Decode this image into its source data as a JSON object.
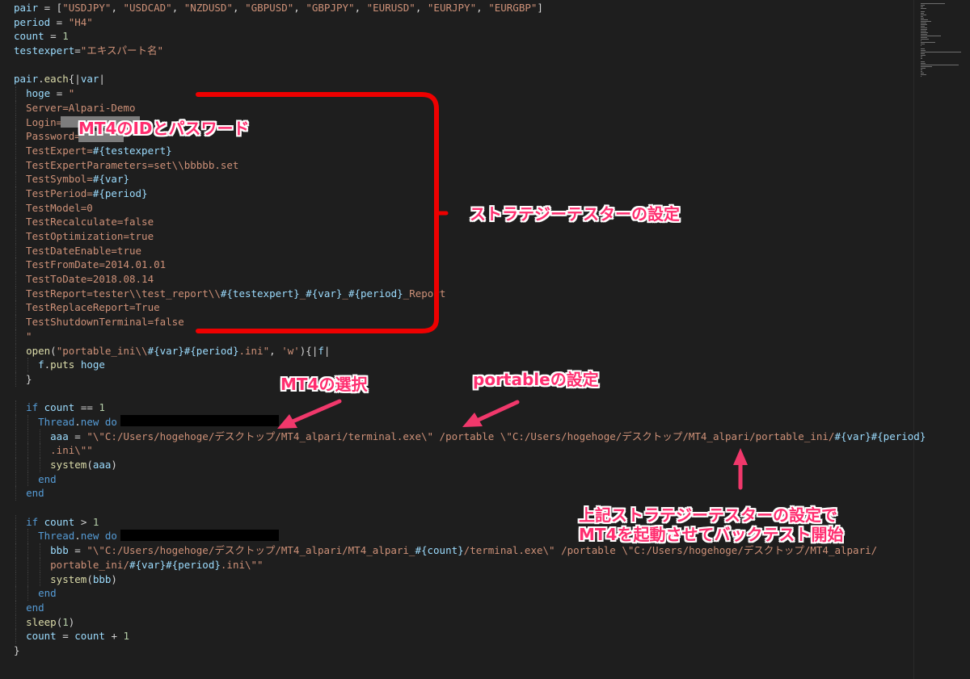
{
  "code_lines": [
    [
      {
        "c": "id",
        "t": "pair"
      },
      {
        "c": "op",
        "t": " = ["
      },
      {
        "c": "str",
        "t": "\"USDJPY\""
      },
      {
        "c": "op",
        "t": ", "
      },
      {
        "c": "str",
        "t": "\"USDCAD\""
      },
      {
        "c": "op",
        "t": ", "
      },
      {
        "c": "str",
        "t": "\"NZDUSD\""
      },
      {
        "c": "op",
        "t": ", "
      },
      {
        "c": "str",
        "t": "\"GBPUSD\""
      },
      {
        "c": "op",
        "t": ", "
      },
      {
        "c": "str",
        "t": "\"GBPJPY\""
      },
      {
        "c": "op",
        "t": ", "
      },
      {
        "c": "str",
        "t": "\"EURUSD\""
      },
      {
        "c": "op",
        "t": ", "
      },
      {
        "c": "str",
        "t": "\"EURJPY\""
      },
      {
        "c": "op",
        "t": ", "
      },
      {
        "c": "str",
        "t": "\"EURGBP\""
      },
      {
        "c": "op",
        "t": "]"
      }
    ],
    [
      {
        "c": "id",
        "t": "period"
      },
      {
        "c": "op",
        "t": " = "
      },
      {
        "c": "str",
        "t": "\"H4\""
      }
    ],
    [
      {
        "c": "id",
        "t": "count"
      },
      {
        "c": "op",
        "t": " = "
      },
      {
        "c": "num",
        "t": "1"
      }
    ],
    [
      {
        "c": "id",
        "t": "testexpert"
      },
      {
        "c": "op",
        "t": "="
      },
      {
        "c": "str",
        "t": "\"エキスパート名\""
      }
    ],
    [],
    [
      {
        "c": "id",
        "t": "pair"
      },
      {
        "c": "op",
        "t": "."
      },
      {
        "c": "fn",
        "t": "each"
      },
      {
        "c": "op",
        "t": "{|"
      },
      {
        "c": "id",
        "t": "var"
      },
      {
        "c": "op",
        "t": "|"
      }
    ],
    [
      {
        "c": "op",
        "t": "  "
      },
      {
        "c": "id",
        "t": "hoge"
      },
      {
        "c": "op",
        "t": " = "
      },
      {
        "c": "str",
        "t": "\""
      }
    ],
    [
      {
        "c": "str",
        "t": "  Server=Alpari-Demo"
      }
    ],
    [
      {
        "c": "str",
        "t": "  Login="
      }
    ],
    [
      {
        "c": "str",
        "t": "  Password="
      }
    ],
    [
      {
        "c": "str",
        "t": "  TestExpert="
      },
      {
        "c": "interp",
        "t": "#{testexpert}"
      }
    ],
    [
      {
        "c": "str",
        "t": "  TestExpertParameters=set\\\\bbbbb.set"
      }
    ],
    [
      {
        "c": "str",
        "t": "  TestSymbol="
      },
      {
        "c": "interp",
        "t": "#{var}"
      }
    ],
    [
      {
        "c": "str",
        "t": "  TestPeriod="
      },
      {
        "c": "interp",
        "t": "#{period}"
      }
    ],
    [
      {
        "c": "str",
        "t": "  TestModel=0"
      }
    ],
    [
      {
        "c": "str",
        "t": "  TestRecalculate=false"
      }
    ],
    [
      {
        "c": "str",
        "t": "  TestOptimization=true"
      }
    ],
    [
      {
        "c": "str",
        "t": "  TestDateEnable=true"
      }
    ],
    [
      {
        "c": "str",
        "t": "  TestFromDate=2014.01.01"
      }
    ],
    [
      {
        "c": "str",
        "t": "  TestToDate=2018.08.14"
      }
    ],
    [
      {
        "c": "str",
        "t": "  TestReport=tester\\\\test_report\\\\"
      },
      {
        "c": "interp",
        "t": "#{testexpert}"
      },
      {
        "c": "str",
        "t": "_"
      },
      {
        "c": "interp",
        "t": "#{var}"
      },
      {
        "c": "str",
        "t": "_"
      },
      {
        "c": "interp",
        "t": "#{period}"
      },
      {
        "c": "str",
        "t": "_Report"
      }
    ],
    [
      {
        "c": "str",
        "t": "  TestReplaceReport=True"
      }
    ],
    [
      {
        "c": "str",
        "t": "  TestShutdownTerminal=false"
      }
    ],
    [
      {
        "c": "str",
        "t": "  \""
      }
    ],
    [
      {
        "c": "op",
        "t": "  "
      },
      {
        "c": "fn",
        "t": "open"
      },
      {
        "c": "op",
        "t": "("
      },
      {
        "c": "str",
        "t": "\"portable_ini\\\\"
      },
      {
        "c": "interp",
        "t": "#{var}#{period}"
      },
      {
        "c": "str",
        "t": ".ini\""
      },
      {
        "c": "op",
        "t": ", "
      },
      {
        "c": "str",
        "t": "'w'"
      },
      {
        "c": "op",
        "t": "){|"
      },
      {
        "c": "id",
        "t": "f"
      },
      {
        "c": "op",
        "t": "|"
      }
    ],
    [
      {
        "c": "op",
        "t": "    "
      },
      {
        "c": "id",
        "t": "f"
      },
      {
        "c": "op",
        "t": "."
      },
      {
        "c": "fn",
        "t": "puts"
      },
      {
        "c": "op",
        "t": " "
      },
      {
        "c": "id",
        "t": "hoge"
      }
    ],
    [
      {
        "c": "op",
        "t": "  }"
      }
    ],
    [],
    [
      {
        "c": "op",
        "t": "  "
      },
      {
        "c": "kw",
        "t": "if"
      },
      {
        "c": "op",
        "t": " "
      },
      {
        "c": "id",
        "t": "count"
      },
      {
        "c": "op",
        "t": " == "
      },
      {
        "c": "num",
        "t": "1"
      }
    ],
    [
      {
        "c": "op",
        "t": "    "
      },
      {
        "c": "kw",
        "t": "Thread"
      },
      {
        "c": "op",
        "t": "."
      },
      {
        "c": "kw",
        "t": "new"
      },
      {
        "c": "op",
        "t": " "
      },
      {
        "c": "kw",
        "t": "do"
      }
    ],
    [
      {
        "c": "op",
        "t": "      "
      },
      {
        "c": "id",
        "t": "aaa"
      },
      {
        "c": "op",
        "t": " = "
      },
      {
        "c": "str",
        "t": "\"\\\"C:/Users/hogehoge/デスクトップ/MT4_alpari/terminal.exe\\\" /portable \\\"C:/Users/hogehoge/デスクトップ/MT4_alpari/portable_ini/"
      },
      {
        "c": "interp",
        "t": "#{var}#{period}"
      }
    ],
    [
      {
        "c": "str",
        "t": "      .ini\\\"\""
      }
    ],
    [
      {
        "c": "op",
        "t": "      "
      },
      {
        "c": "fn",
        "t": "system"
      },
      {
        "c": "op",
        "t": "("
      },
      {
        "c": "id",
        "t": "aaa"
      },
      {
        "c": "op",
        "t": ")"
      }
    ],
    [
      {
        "c": "op",
        "t": "    "
      },
      {
        "c": "kw",
        "t": "end"
      }
    ],
    [
      {
        "c": "op",
        "t": "  "
      },
      {
        "c": "kw",
        "t": "end"
      }
    ],
    [],
    [
      {
        "c": "op",
        "t": "  "
      },
      {
        "c": "kw",
        "t": "if"
      },
      {
        "c": "op",
        "t": " "
      },
      {
        "c": "id",
        "t": "count"
      },
      {
        "c": "op",
        "t": " > "
      },
      {
        "c": "num",
        "t": "1"
      }
    ],
    [
      {
        "c": "op",
        "t": "    "
      },
      {
        "c": "kw",
        "t": "Thread"
      },
      {
        "c": "op",
        "t": "."
      },
      {
        "c": "kw",
        "t": "new"
      },
      {
        "c": "op",
        "t": " "
      },
      {
        "c": "kw",
        "t": "do"
      }
    ],
    [
      {
        "c": "op",
        "t": "      "
      },
      {
        "c": "id",
        "t": "bbb"
      },
      {
        "c": "op",
        "t": " = "
      },
      {
        "c": "str",
        "t": "\"\\\"C:/Users/hogehoge/デスクトップ/MT4_alpari/MT4_alpari_"
      },
      {
        "c": "interp",
        "t": "#{count}"
      },
      {
        "c": "str",
        "t": "/terminal.exe\\\" /portable \\\"C:/Users/hogehoge/デスクトップ/MT4_alpari/"
      }
    ],
    [
      {
        "c": "str",
        "t": "      portable_ini/"
      },
      {
        "c": "interp",
        "t": "#{var}#{period}"
      },
      {
        "c": "str",
        "t": ".ini\\\"\""
      }
    ],
    [
      {
        "c": "op",
        "t": "      "
      },
      {
        "c": "fn",
        "t": "system"
      },
      {
        "c": "op",
        "t": "("
      },
      {
        "c": "id",
        "t": "bbb"
      },
      {
        "c": "op",
        "t": ")"
      }
    ],
    [
      {
        "c": "op",
        "t": "    "
      },
      {
        "c": "kw",
        "t": "end"
      }
    ],
    [
      {
        "c": "op",
        "t": "  "
      },
      {
        "c": "kw",
        "t": "end"
      }
    ],
    [
      {
        "c": "op",
        "t": "  "
      },
      {
        "c": "fn",
        "t": "sleep"
      },
      {
        "c": "op",
        "t": "("
      },
      {
        "c": "num",
        "t": "1"
      },
      {
        "c": "op",
        "t": ")"
      }
    ],
    [
      {
        "c": "op",
        "t": "  "
      },
      {
        "c": "id",
        "t": "count"
      },
      {
        "c": "op",
        "t": " = "
      },
      {
        "c": "id",
        "t": "count"
      },
      {
        "c": "op",
        "t": " + "
      },
      {
        "c": "num",
        "t": "1"
      }
    ],
    [
      {
        "c": "op",
        "t": "}"
      }
    ]
  ],
  "annotations": {
    "id_password": "MT4のIDとパスワード",
    "strategy_tester": "ストラテジーテスターの設定",
    "mt4_select": "MT4の選択",
    "portable_setting": "portableの設定",
    "launch_note": "上記ストラテジーテスターの設定でMT4を起動させてバックテスト開始"
  },
  "colors": {
    "background": "#1e1e1e",
    "annotation": "#ff2d6f",
    "bracket": "#ee0000",
    "arrow": "#f0386b"
  }
}
